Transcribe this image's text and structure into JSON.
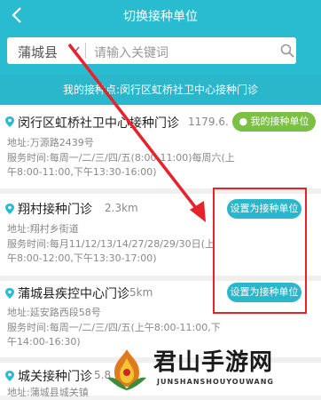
{
  "header": {
    "title": "切换接种单位"
  },
  "search": {
    "county": "蒲城县",
    "placeholder": "请输入关键词"
  },
  "my_station": "我的接种点:闵行区虹桥社卫中心接种门诊",
  "items": [
    {
      "name": "闵行区虹桥社卫中心接种门诊",
      "distance": "1179.6.",
      "button": "我的接种单位",
      "address": "地址:万源路2439号",
      "hours1": "服务时间:每周一/二/三/四/五(8:00-11:00)每周六(上",
      "hours2": "午8:00-11:00,下午13:30-16:00)"
    },
    {
      "name": "翔村接种门诊",
      "distance": "2.3km",
      "button": "设置为接种单位",
      "address": "地址:翔村乡街道",
      "hours1": "服务时间:每月11/12/13/14/27/28/29/30日(上",
      "hours2": "午8:00-12:00,下午13:30-17:00)"
    },
    {
      "name": "蒲城县疾控中心门诊",
      "distance": "5km",
      "button": "设置为接种单位",
      "address": "地址:延安路西段58号",
      "hours1": "服务时间:每周一/二/三/四/五(上午8:00-11:00,下",
      "hours2": "午14:00-16:30)"
    },
    {
      "name": "城关接种门诊",
      "distance": "5.8",
      "address": "地址:蒲城县城关镇"
    }
  ],
  "watermark": {
    "main": "君山手游网",
    "sub": "JUNSHANSHOUYOUWANG"
  },
  "colors": {
    "accent": "#29bcd0",
    "green": "#7bc043",
    "highlight": "#e8222a"
  }
}
